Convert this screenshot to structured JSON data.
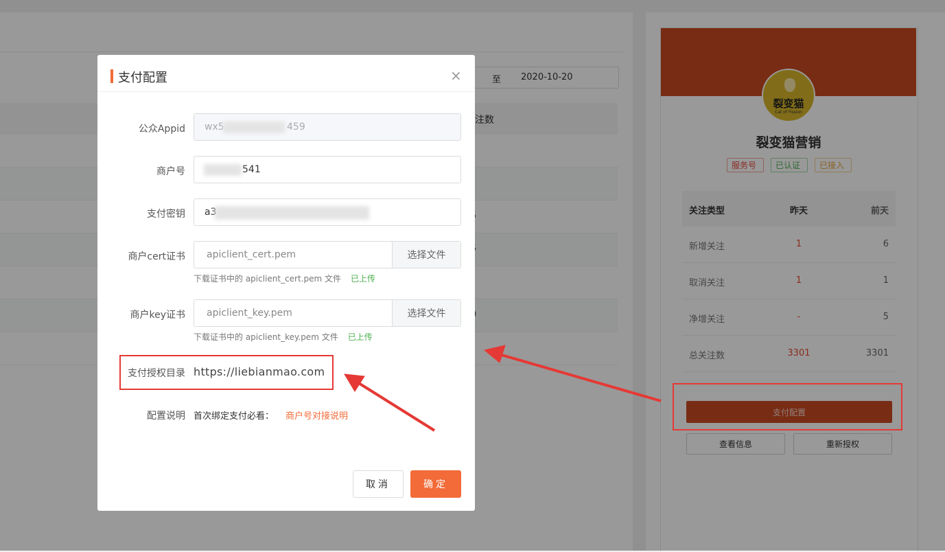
{
  "background": {
    "date_to": "至",
    "date_end": "2020-10-20",
    "table_header": "注数",
    "row_tails": [
      "",
      "",
      "5",
      "5",
      "",
      "0",
      ""
    ]
  },
  "account": {
    "logo_text": "裂变猫",
    "logo_sub": "Cat of Fission",
    "name": "裂变猫营销",
    "tags": [
      "服务号",
      "已认证",
      "已接入"
    ],
    "stats_header": [
      "关注类型",
      "昨天",
      "前天"
    ],
    "stats_rows": [
      {
        "type": "新增关注",
        "yesterday": "1",
        "before": "6"
      },
      {
        "type": "取消关注",
        "yesterday": "1",
        "before": "1"
      },
      {
        "type": "净增关注",
        "yesterday": "-",
        "before": "5"
      },
      {
        "type": "总关注数",
        "yesterday": "3301",
        "before": "3301"
      }
    ],
    "pay_config_button": "支付配置",
    "view_info_button": "查看信息",
    "reauth_button": "重新授权"
  },
  "modal": {
    "title": "支付配置",
    "close": "×",
    "appid_label": "公众Appid",
    "appid_prefix": "wx5",
    "appid_suffix": "459",
    "merchant_label": "商户号",
    "merchant_value": "541",
    "secret_label": "支付密钥",
    "secret_value": "a3",
    "cert_label": "商户cert证书",
    "cert_file": "apiclient_cert.pem",
    "cert_hint": "下载证书中的 apiclient_cert.pem 文件",
    "cert_status": "已上传",
    "key_label": "商户key证书",
    "key_file": "apiclient_key.pem",
    "key_hint": "下载证书中的 apiclient_key.pem 文件",
    "key_status": "已上传",
    "choose_file": "选择文件",
    "auth_dir_label": "支付授权目录",
    "auth_dir_value": "https://liebianmao.com",
    "note_label": "配置说明",
    "note_text": "首次绑定支付必看：",
    "note_link": "商户号对接说明",
    "cancel": "取消",
    "ok": "确定"
  },
  "colors": {
    "accent": "#f26b38",
    "brand_banner": "#c94a22",
    "highlight": "#e53935",
    "success": "#4caf50"
  }
}
